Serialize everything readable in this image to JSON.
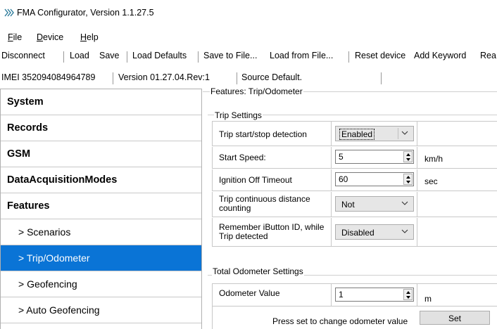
{
  "window": {
    "title": "FMA Configurator, Version 1.1.27.5"
  },
  "menu": {
    "items": [
      {
        "label": "File",
        "accel": "F",
        "rest": "ile"
      },
      {
        "label": "Device",
        "accel": "D",
        "rest": "evice"
      },
      {
        "label": "Help",
        "accel": "H",
        "rest": "elp"
      }
    ]
  },
  "toolbar": {
    "items": [
      "Disconnect",
      "Load",
      "Save",
      "Load Defaults",
      "Save to File...",
      "Load from File...",
      "Reset device",
      "Add Keyword",
      "Rea"
    ]
  },
  "status": {
    "imei": "IMEI  352094084964789",
    "version": "Version  01.27.04.Rev:1",
    "source": "Source  Default."
  },
  "nav": {
    "items": [
      {
        "label": "System",
        "sub": false,
        "active": false
      },
      {
        "label": "Records",
        "sub": false,
        "active": false
      },
      {
        "label": "GSM",
        "sub": false,
        "active": false
      },
      {
        "label": "DataAcquisitionModes",
        "sub": false,
        "active": false
      },
      {
        "label": "Features",
        "sub": false,
        "active": false
      },
      {
        "label": "> Scenarios",
        "sub": true,
        "active": false
      },
      {
        "label": "> Trip/Odometer",
        "sub": true,
        "active": true
      },
      {
        "label": "> Geofencing",
        "sub": true,
        "active": false
      },
      {
        "label": "> Auto Geofencing",
        "sub": true,
        "active": false
      }
    ]
  },
  "content": {
    "features_group": "Features: Trip/Odometer",
    "trip_group": "Trip Settings",
    "trip_rows": {
      "detection": {
        "label": "Trip start/stop detection",
        "value": "Enabled"
      },
      "start_speed": {
        "label": "Start Speed:",
        "value": "5",
        "unit": "km/h"
      },
      "ignition_timeout": {
        "label": "Ignition Off Timeout",
        "value": "60",
        "unit": "sec"
      },
      "continuous": {
        "label_line1": "Trip continuous distance",
        "label_line2": "counting",
        "value": "Not"
      },
      "ibutton": {
        "label_line1": "Remember iButton ID, while",
        "label_line2": "Trip detected",
        "value": "Disabled"
      }
    },
    "odo_group": "Total Odometer Settings",
    "odometer": {
      "label": "Odometer Value",
      "value": "1",
      "unit": "m"
    },
    "press_text": "Press set to change odometer value",
    "set_label": "Set"
  },
  "colors": {
    "active_nav": "#0a74d6",
    "grid_line": "#c8c8c8"
  },
  "icons": {
    "app": "fma-app-icon",
    "chevron": "chevron-down-icon",
    "spin": "spinner-icon"
  }
}
